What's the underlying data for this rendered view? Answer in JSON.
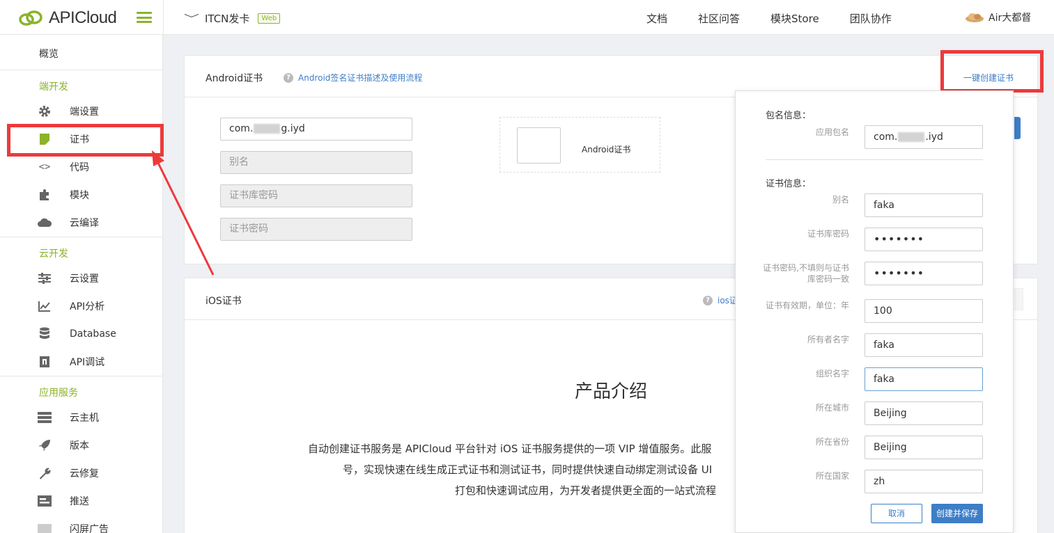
{
  "brand": {
    "name": "APICloud",
    "accent": "#8ab32a",
    "link": "#3d7ec7",
    "highlight": "#ec3a3c"
  },
  "header": {
    "project_name": "ITCN发卡",
    "project_badge": "Web",
    "nav": [
      "文档",
      "社区问答",
      "模块Store",
      "团队协作"
    ],
    "user_name": "Air大都督"
  },
  "sidebar": {
    "overview": "概览",
    "sections": [
      {
        "title": "端开发",
        "items": [
          "端设置",
          "证书",
          "代码",
          "模块",
          "云编译"
        ]
      },
      {
        "title": "云开发",
        "items": [
          "云设置",
          "API分析",
          "Database",
          "API调试"
        ]
      },
      {
        "title": "应用服务",
        "items": [
          "云主机",
          "版本",
          "云修复",
          "推送",
          "闪屏广告"
        ]
      }
    ],
    "active_item": "证书"
  },
  "android_card": {
    "title": "Android证书",
    "help_link": "Android签名证书描述及使用流程",
    "create_link": "一键创建证书",
    "package_prefix": "com.",
    "package_mid": "g",
    "package_suffix": ".iyd",
    "placeholders": {
      "alias": "别名",
      "store_password": "证书库密码",
      "cert_password": "证书密码"
    },
    "upload_label": "Android证书"
  },
  "ios_card": {
    "title": "iOS证书",
    "help_link": "ios证"
  },
  "intro": {
    "title": "产品介绍",
    "lines": [
      "自动创建证书服务是 APICloud 平台针对 iOS 证书服务提供的一项 VIP 增值服务。此服",
      "号，实现快速在线生成正式证书和测试证书，同时提供快速自动绑定测试设备 UI",
      "打包和快速调试应用，为开发者提供更全面的一站式流程"
    ]
  },
  "popup": {
    "package_section": "包名信息：",
    "package_label": "应用包名",
    "package_prefix": "com.",
    "package_suffix": ".iyd",
    "cert_section": "证书信息：",
    "fields": [
      {
        "label": "别名",
        "value": "faka"
      },
      {
        "label": "证书库密码",
        "value": "•••••••"
      },
      {
        "label": "证书密码,不填则与证书库密码一致",
        "value": "•••••••"
      },
      {
        "label": "证书有效期，单位：年",
        "value": "100"
      },
      {
        "label": "所有者名字",
        "value": "faka"
      },
      {
        "label": "组织名字",
        "value": "faka"
      },
      {
        "label": "所在城市",
        "value": "Beijing"
      },
      {
        "label": "所在省份",
        "value": "Beijing"
      },
      {
        "label": "所在国家",
        "value": "zh"
      }
    ],
    "cancel": "取消",
    "save": "创建并保存"
  }
}
